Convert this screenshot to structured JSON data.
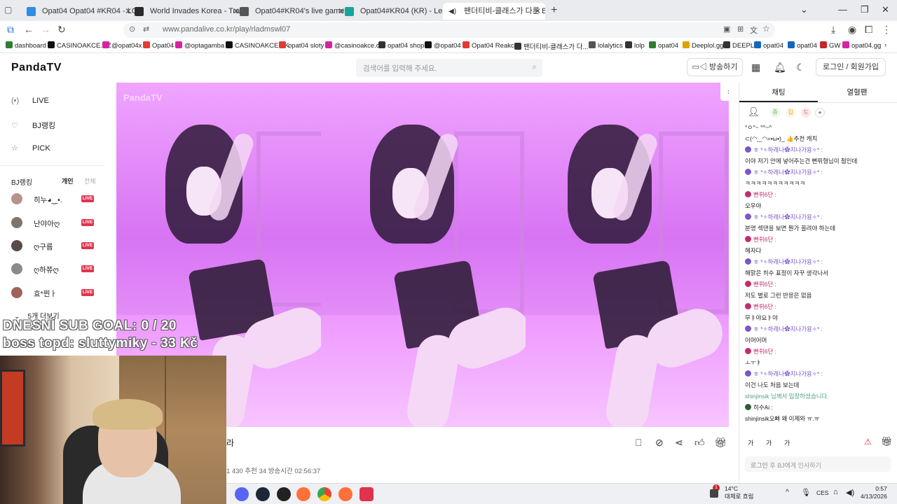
{
  "browser": {
    "tabs": [
      {
        "title": "Opat04 Opat04 #KR04 - LOL STA",
        "color": "#2f8ee0"
      },
      {
        "title": "World Invades Korea - TrackDiff",
        "color": "#2a2a2a"
      },
      {
        "title": "Opat04#KR04's live game - Porc",
        "color": "#555"
      },
      {
        "title": "Opat04#KR04 (KR) - LeagueOfG",
        "color": "#1aa39a"
      },
      {
        "title": "팬더티비-클래스가 다른 BJ",
        "color": "#fff"
      }
    ],
    "url": "www.pandalive.co.kr/play/rladmswl07",
    "bookmarks": [
      {
        "label": "dashboard",
        "color": "#2e7d32"
      },
      {
        "label": "CASINOAKCE.CZ",
        "color": "#111"
      },
      {
        "label": "@opat04x",
        "color": "#d6249f"
      },
      {
        "label": "Opat04",
        "color": "#e53935"
      },
      {
        "label": "@optagamba",
        "color": "#d6249f"
      },
      {
        "label": "CASINOAKCE.SK",
        "color": "#111"
      },
      {
        "label": "opat04 sloty",
        "color": "#e53935"
      },
      {
        "label": "@casinoakce.cz",
        "color": "#d6249f"
      },
      {
        "label": "opat04 shop",
        "color": "#333"
      },
      {
        "label": "@opat04",
        "color": "#111"
      },
      {
        "label": "Opat04 Reakce",
        "color": "#e53935"
      },
      {
        "label": "팬더티비-클래스가 다...",
        "color": "#333"
      },
      {
        "label": "lolalytics",
        "color": "#555"
      },
      {
        "label": "lolp",
        "color": "#333"
      },
      {
        "label": "opat04",
        "color": "#2e7d32"
      },
      {
        "label": "Deeplol.gg",
        "color": "#e0a100"
      },
      {
        "label": "DEEPL",
        "color": "#333"
      },
      {
        "label": "opat04",
        "color": "#1565c0"
      },
      {
        "label": "opat04",
        "color": "#1565c0"
      },
      {
        "label": "GW",
        "color": "#c62828"
      },
      {
        "label": "opat04.gg",
        "color": "#d6249f"
      }
    ]
  },
  "site": {
    "logo": "PandaTV",
    "search_placeholder": "검색어를 입력해 주세요.",
    "broadcast_button": "방송하기",
    "login_button": "로그인 / 회원가입"
  },
  "sidebar": {
    "nav": [
      {
        "label": "LIVE",
        "icon": "(•)"
      },
      {
        "label": "BJ랭킹",
        "icon": "♡"
      },
      {
        "label": "PICK",
        "icon": "☆"
      }
    ],
    "ranking_title": "BJ랭킹",
    "ranking_tab_personal": "개인",
    "ranking_tab_all": "전체",
    "streamers": [
      {
        "name": "히누◕‿•.",
        "live": "LIVE"
      },
      {
        "name": "난야아ღ",
        "live": "LIVE"
      },
      {
        "name": "ღ구름",
        "live": "LIVE"
      },
      {
        "name": "ღ하쮸ღ",
        "live": "LIVE"
      },
      {
        "name": "효*찐ㅏ",
        "live": "LIVE"
      }
    ],
    "more": "5개 더보기"
  },
  "overlay": {
    "goal": "DNESNÍ SUB GOAL: 0 / 20",
    "boss": "boss topd:  sluttymiky - 33 Kč"
  },
  "video_info": {
    "title_fragment": "라",
    "stats": "1 430  추천 34  방송시간 02:56:37"
  },
  "chat": {
    "tabs": [
      "채팅",
      "열혈팬"
    ],
    "filter_chips": [
      "쥬",
      "김",
      "드",
      "+"
    ],
    "lines": [
      {
        "type": "text",
        "text": "°ㅇ°~   °^~^"
      },
      {
        "type": "text",
        "text": "⊂(◠‿◠=•ω•)_  👍추천 캐치"
      },
      {
        "type": "nick",
        "nick": "ㅎ *✧하레나✿지나가용✧* :",
        "red": false
      },
      {
        "type": "text",
        "text": "이야 저기 안에 넣어주는건 뻔뤼형님이 첨인데"
      },
      {
        "type": "nick",
        "nick": "ㅎ *✧하레나✿지나가용✧* :",
        "red": false
      },
      {
        "type": "text",
        "text": "ㅋㅋㅋㅋㅋㅋㅋㅋㅋㅋㅋ"
      },
      {
        "type": "nick",
        "nick": "뻔뤼6단 :",
        "red": true
      },
      {
        "type": "text",
        "text": "오우야"
      },
      {
        "type": "nick",
        "nick": "ㅎ *✧하레나✿지나가용✧* :",
        "red": false
      },
      {
        "type": "text",
        "text": "분명 섹댄을 보면 뭔가 꼴려야 하는데"
      },
      {
        "type": "nick",
        "nick": "뻔뤼6단 :",
        "red": true
      },
      {
        "type": "text",
        "text": "헤자다"
      },
      {
        "type": "nick",
        "nick": "ㅎ *✧하레나✿지나가용✧* :",
        "red": false
      },
      {
        "type": "text",
        "text": "해맑은 히수 표정이 자꾸 생각나서"
      },
      {
        "type": "nick",
        "nick": "뻔뤼6단 :",
        "red": true
      },
      {
        "type": "text",
        "text": "저도 별로 그런 반응은 없음"
      },
      {
        "type": "nick",
        "nick": "뻔뤼6단 :",
        "red": true
      },
      {
        "type": "text",
        "text": "무ㅑ야요ㅑ야"
      },
      {
        "type": "nick",
        "nick": "ㅎ *✧하레나✿지나가용✧* :",
        "red": false
      },
      {
        "type": "text",
        "text": "어머어머"
      },
      {
        "type": "nick",
        "nick": "뻔뤼6단 :",
        "red": true
      },
      {
        "type": "text",
        "text": "ㅗㅜㅑ"
      },
      {
        "type": "nick",
        "nick": "ㅎ *✧하레나✿지나가용✧* :",
        "red": false
      },
      {
        "type": "text",
        "text": "이건 나도 처음 보는데"
      },
      {
        "type": "sys",
        "text": "shinjinsik 님께서 입장하셨습니다."
      },
      {
        "type": "nick2",
        "nick": "히수Ai :"
      },
      {
        "type": "text",
        "text": "shinjinsik오빠 왜 이제와 ㅠ.ㅠ"
      }
    ],
    "font_buttons": [
      "가",
      "가",
      "가"
    ],
    "input_placeholder": "로그인 후 BJ에게 인사하기",
    "login": "로그인"
  },
  "taskbar": {
    "weather_temp": "14°C",
    "weather_desc": "대체로 흐림",
    "lang": "CES",
    "time": "0:57",
    "date": "4/13/2026",
    "notification_count": "1"
  }
}
